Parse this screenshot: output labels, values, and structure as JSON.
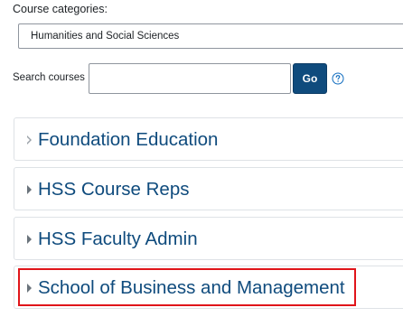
{
  "course_categories": {
    "label": "Course categories:",
    "selected": "Humanities and Social Sciences"
  },
  "search": {
    "label": "Search courses",
    "value": "",
    "button_label": "Go",
    "help_icon": "question-circle-icon"
  },
  "categories": [
    {
      "name": "Foundation Education",
      "icon": "caret-right-outline-icon"
    },
    {
      "name": "HSS Course Reps",
      "icon": "caret-right-icon"
    },
    {
      "name": "HSS Faculty Admin",
      "icon": "caret-right-icon"
    },
    {
      "name": "School of Business and Management",
      "icon": "caret-right-icon"
    }
  ],
  "colors": {
    "link": "#0f4b7d",
    "button_bg": "#0f4b7d",
    "border": "#dee2e6",
    "highlight": "#e0151a"
  }
}
